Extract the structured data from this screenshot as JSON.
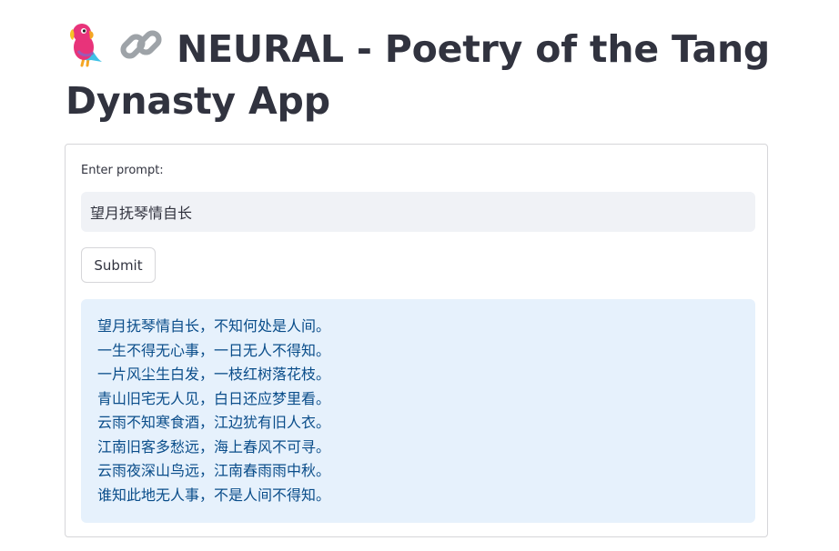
{
  "header": {
    "title": "NEURAL - Poetry of the Tang Dynasty App",
    "icons": [
      "parrot-icon",
      "link-icon"
    ]
  },
  "form": {
    "prompt_label": "Enter prompt:",
    "prompt_value": "望月抚琴情自长",
    "submit_label": "Submit"
  },
  "output": {
    "lines": [
      "望月抚琴情自长，不知何处是人间。",
      "一生不得无心事，一日无人不得知。",
      "一片风尘生白发，一枝红树落花枝。",
      "青山旧宅无人见，白日还应梦里看。",
      "云雨不知寒食酒，江边犹有旧人衣。",
      "江南旧客多愁远，海上春风不可寻。",
      "云雨夜深山鸟远，江南春雨雨中秋。",
      "谁知此地无人事，不是人间不得知。"
    ]
  },
  "colors": {
    "text": "#31333f",
    "input_bg": "#f0f2f6",
    "output_bg": "#e6f1fc",
    "output_text": "#0a4d8a",
    "border": "#d6d6d9"
  }
}
